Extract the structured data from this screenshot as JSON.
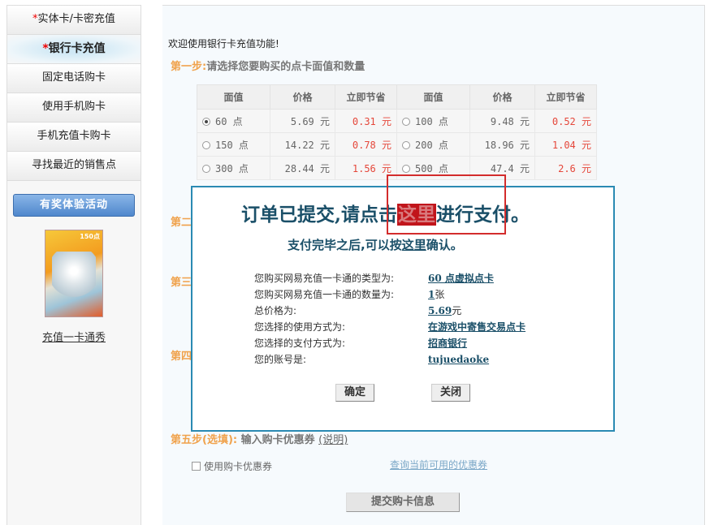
{
  "sidebar": {
    "items": [
      {
        "star": "*",
        "label": "实体卡/卡密充值"
      },
      {
        "star": "*",
        "label": "银行卡充值"
      },
      {
        "star": "",
        "label": "固定电话购卡"
      },
      {
        "star": "",
        "label": "使用手机购卡"
      },
      {
        "star": "",
        "label": "手机充值卡购卡"
      },
      {
        "star": "",
        "label": "寻找最近的销售点"
      }
    ],
    "promo_button": "有奖体验活动",
    "promo_card_label": "150点",
    "promo_link": "充值一卡通秀"
  },
  "main": {
    "welcome": "欢迎使用银行卡充值功能!",
    "step1_label": "第一步:",
    "step1_text": "请选择您要购买的点卡面值和数量",
    "table": {
      "headers": [
        "面值",
        "价格",
        "立即节省",
        "面值",
        "价格",
        "立即节省"
      ],
      "rows": [
        {
          "left": {
            "face": "60 点",
            "price": "5.69 元",
            "save": "0.31 元",
            "selected": true
          },
          "right": {
            "face": "100 点",
            "price": "9.48 元",
            "save": "0.52 元",
            "selected": false
          }
        },
        {
          "left": {
            "face": "150 点",
            "price": "14.22 元",
            "save": "0.78 元",
            "selected": false
          },
          "right": {
            "face": "200 点",
            "price": "18.96 元",
            "save": "1.04 元",
            "selected": false
          }
        },
        {
          "left": {
            "face": "300 点",
            "price": "28.44 元",
            "save": "1.56 元",
            "selected": false
          },
          "right": {
            "face": "500 点",
            "price": "47.4 元",
            "save": "2.6 元",
            "selected": false
          }
        }
      ]
    },
    "step2_label": "第二",
    "step3_label": "第三",
    "step4_label": "第四",
    "step5_label": "第五步(选填):",
    "step5_text": "输入购卡优惠券",
    "step5_explain": "(说明)",
    "coupon_checkbox_label": "使用购卡优惠券",
    "coupon_link": "查询当前可用的优惠券",
    "submit_button": "提交购卡信息"
  },
  "dialog": {
    "title_pre": "订单已提交,请点击",
    "title_link": "这里",
    "title_post": "进行支付。",
    "sub_pre": "支付完毕之后,可以按",
    "sub_link": "这里",
    "sub_post": "确认。",
    "info": [
      {
        "key": "您购买网易充值一卡通的类型为:",
        "value": "60 点虚拟点卡",
        "suffix": ""
      },
      {
        "key": "您购买网易充值一卡通的数量为:",
        "value": "1",
        "suffix": "张"
      },
      {
        "key": "总价格为:",
        "value": "5.69",
        "suffix": "元"
      },
      {
        "key": "您选择的使用方式为:",
        "value": "在游戏中寄售交易点卡",
        "suffix": ""
      },
      {
        "key": "您选择的支付方式为:",
        "value": "招商银行",
        "suffix": ""
      },
      {
        "key": "您的账号是:",
        "value": "tujuedaoke",
        "suffix": ""
      }
    ],
    "ok_button": "确定",
    "close_button": "关闭"
  },
  "colors": {
    "accent": "#2a8ab3",
    "highlight": "#d32c2c",
    "step": "#f0a24c",
    "saving": "#e5473a"
  }
}
